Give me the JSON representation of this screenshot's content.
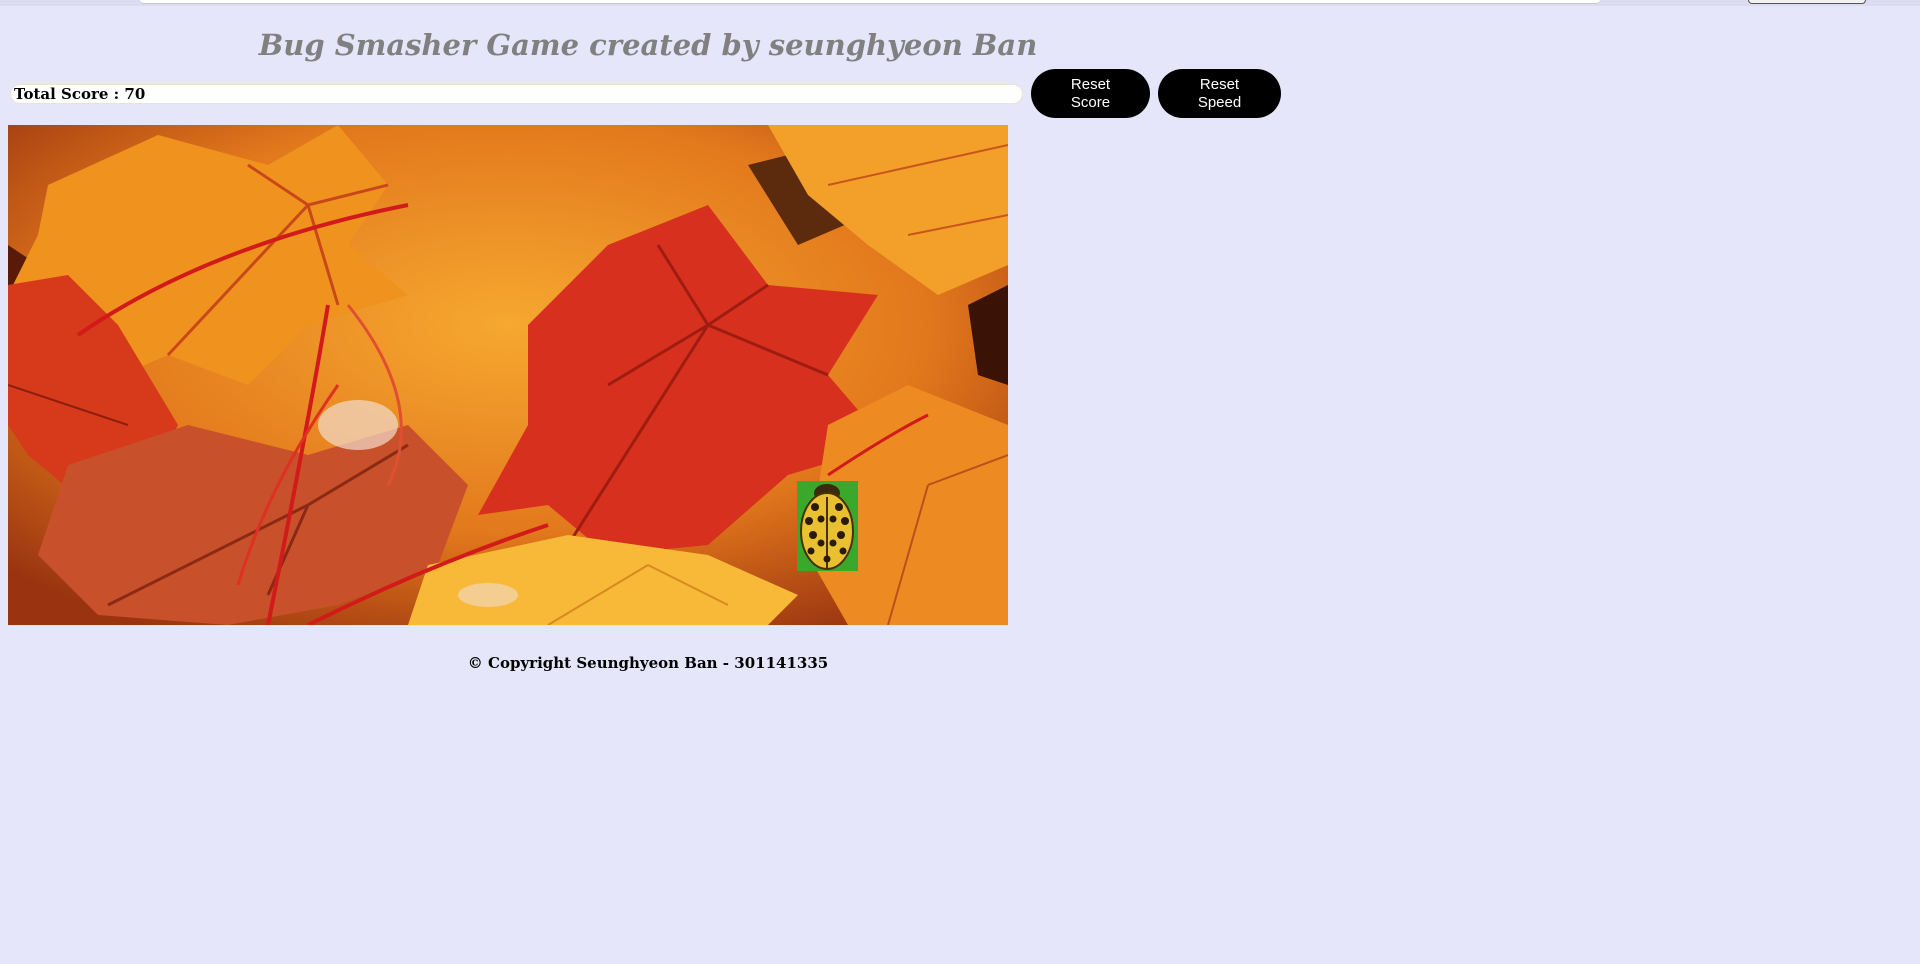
{
  "title": "Bug Smasher Game created by seunghyeon Ban",
  "score": {
    "label": "Total Score : 70",
    "value": 70
  },
  "buttons": {
    "reset_score": "Reset\nScore",
    "reset_speed": "Reset\nSpeed"
  },
  "game": {
    "background": "autumn-maple-leaves",
    "sprite": "ladybug-icon"
  },
  "footer": "© Copyright Seunghyeon Ban - 301141335",
  "colors": {
    "page_bg": "#e6e6fa",
    "title": "#808080",
    "button_bg": "#000000",
    "button_text": "#ffffff"
  }
}
